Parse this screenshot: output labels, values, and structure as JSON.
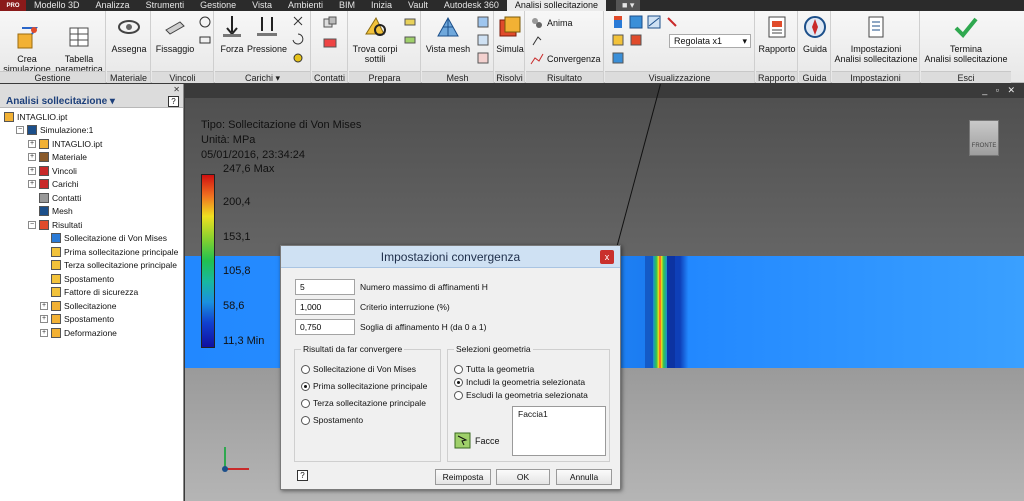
{
  "menubar": {
    "badge": "PRO",
    "tabs": [
      "Modello 3D",
      "Analizza",
      "Strumenti",
      "Gestione",
      "Vista",
      "Ambienti",
      "BIM",
      "Inizia",
      "Vault",
      "Autodesk 360",
      "Analisi sollecitazione"
    ],
    "active_tab": "Analisi sollecitazione",
    "extra": "■ ▾"
  },
  "ribbon": {
    "panels": {
      "gestione": "Gestione",
      "materiale": "Materiale",
      "vincoli": "Vincoli",
      "carichi": "Carichi ▾",
      "contatti": "Contatti",
      "prepara": "Prepara",
      "mesh": "Mesh",
      "risolvi": "Risolvi",
      "risultato": "Risultato",
      "visualizzazione": "Visualizzazione",
      "rapporto": "Rapporto",
      "guida": "Guida",
      "impostazioni": "Impostazioni",
      "esci": "Esci"
    },
    "buttons": {
      "crea": "Crea\nsimulazione",
      "tabella": "Tabella\nparametrica",
      "assegna": "Assegna",
      "fissaggio": "Fissaggio",
      "forza": "Forza",
      "pressione": "Pressione",
      "trova": "Trova corpi\nsottili",
      "vista_mesh": "Vista mesh",
      "simula": "Simula",
      "anima": "Anima",
      "convergenza": "Convergenza",
      "regolata": "Regolata x1",
      "rapporto": "Rapporto",
      "guida": "Guida",
      "impostazioni": "Impostazioni\nAnalisi sollecitazione",
      "termina": "Termina\nAnalisi sollecitazione"
    }
  },
  "browser": {
    "close": "✕",
    "title": "Analisi sollecitazione ▾",
    "help": "?",
    "tree": [
      {
        "label": "INTAGLIO.ipt",
        "level": 0,
        "exp": ""
      },
      {
        "label": "Simulazione:1",
        "level": 1,
        "exp": "−"
      },
      {
        "label": "INTAGLIO.ipt",
        "level": 2,
        "exp": "+"
      },
      {
        "label": "Materiale",
        "level": 2,
        "exp": "+"
      },
      {
        "label": "Vincoli",
        "level": 2,
        "exp": "+"
      },
      {
        "label": "Carichi",
        "level": 2,
        "exp": "+"
      },
      {
        "label": "Contatti",
        "level": 2,
        "exp": ""
      },
      {
        "label": "Mesh",
        "level": 2,
        "exp": ""
      },
      {
        "label": "Risultati",
        "level": 2,
        "exp": "−"
      },
      {
        "label": "Sollecitazione di Von Mises",
        "level": 3,
        "exp": ""
      },
      {
        "label": "Prima sollecitazione principale",
        "level": 3,
        "exp": ""
      },
      {
        "label": "Terza sollecitazione principale",
        "level": 3,
        "exp": ""
      },
      {
        "label": "Spostamento",
        "level": 3,
        "exp": ""
      },
      {
        "label": "Fattore di sicurezza",
        "level": 3,
        "exp": ""
      },
      {
        "label": "Sollecitazione",
        "level": 3,
        "exp": "+"
      },
      {
        "label": "Spostamento",
        "level": 3,
        "exp": "+"
      },
      {
        "label": "Deformazione",
        "level": 3,
        "exp": "+"
      }
    ]
  },
  "viewport": {
    "window_controls": "_ ▫ ✕",
    "legend": {
      "type": "Tipo: Sollecitazione di Von Mises",
      "unit": "Unità: MPa",
      "date": "05/01/2016, 23:34:24",
      "labels": [
        "247,6 Max",
        "200,4",
        "153,1",
        "105,8",
        "58,6",
        "11,3 Min"
      ]
    },
    "viewcube": "FRONTE"
  },
  "dialog": {
    "title": "Impostazioni convergenza",
    "close": "x",
    "fields": [
      {
        "value": "5",
        "label": "Numero massimo di affinamenti H"
      },
      {
        "value": "1,000",
        "label": "Criterio interruzione (%)"
      },
      {
        "value": "0,750",
        "label": "Soglia di affinamento H (da 0 a 1)"
      }
    ],
    "results_group": {
      "title": "Risultati da far convergere",
      "options": [
        "Sollecitazione di Von Mises",
        "Prima sollecitazione principale",
        "Terza sollecitazione principale",
        "Spostamento"
      ],
      "selected": 1
    },
    "geometry_group": {
      "title": "Selezioni geometria",
      "options": [
        "Tutta la geometria",
        "Includi la geometria selezionata",
        "Escludi la geometria selezionata"
      ],
      "selected": 1,
      "facce_label": "Facce",
      "list_items": [
        "Faccia1"
      ]
    },
    "help": "?",
    "buttons": {
      "reset": "Reimposta",
      "ok": "OK",
      "cancel": "Annulla"
    }
  }
}
